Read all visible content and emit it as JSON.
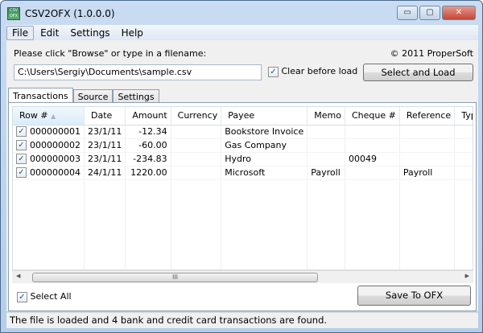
{
  "window": {
    "title": "CSV2OFX (1.0.0.0)",
    "app_icon_text": "CSV OFX",
    "minimize": "▭",
    "maximize": "▢",
    "close": "✕"
  },
  "menu": [
    "File",
    "Edit",
    "Settings",
    "Help"
  ],
  "prompt": "Please click \"Browse\" or type in a filename:",
  "copyright": "© 2011 ProperSoft",
  "filename": "C:\\Users\\Sergiy\\Documents\\sample.csv",
  "clear_before_load": {
    "label": "Clear before load",
    "checked": true
  },
  "select_and_load": "Select and Load",
  "tabs": [
    "Transactions",
    "Source",
    "Settings"
  ],
  "table": {
    "columns": [
      "Row #",
      "Date",
      "Amount",
      "Currency",
      "Payee",
      "Memo",
      "Cheque #",
      "Reference",
      "Type"
    ],
    "rows": [
      {
        "checked": true,
        "cells": [
          "000000001",
          "23/1/11",
          "-12.34",
          "",
          "Bookstore Invoice",
          "",
          "",
          "",
          ""
        ]
      },
      {
        "checked": true,
        "cells": [
          "000000002",
          "23/1/11",
          "-60.00",
          "",
          "Gas Company",
          "",
          "",
          "",
          ""
        ]
      },
      {
        "checked": true,
        "cells": [
          "000000003",
          "23/1/11",
          "-234.83",
          "",
          "Hydro",
          "",
          "00049",
          "",
          ""
        ]
      },
      {
        "checked": true,
        "cells": [
          "000000004",
          "24/1/11",
          "1220.00",
          "",
          "Microsoft",
          "Payroll",
          "",
          "Payroll",
          ""
        ]
      }
    ]
  },
  "scroll_grip": "III",
  "select_all": {
    "label": "Select All",
    "checked": true
  },
  "save_button": "Save To OFX",
  "status": "The file is loaded and 4 bank and credit card transactions are found.",
  "check_glyph": "✓",
  "sort_glyph": "▲"
}
